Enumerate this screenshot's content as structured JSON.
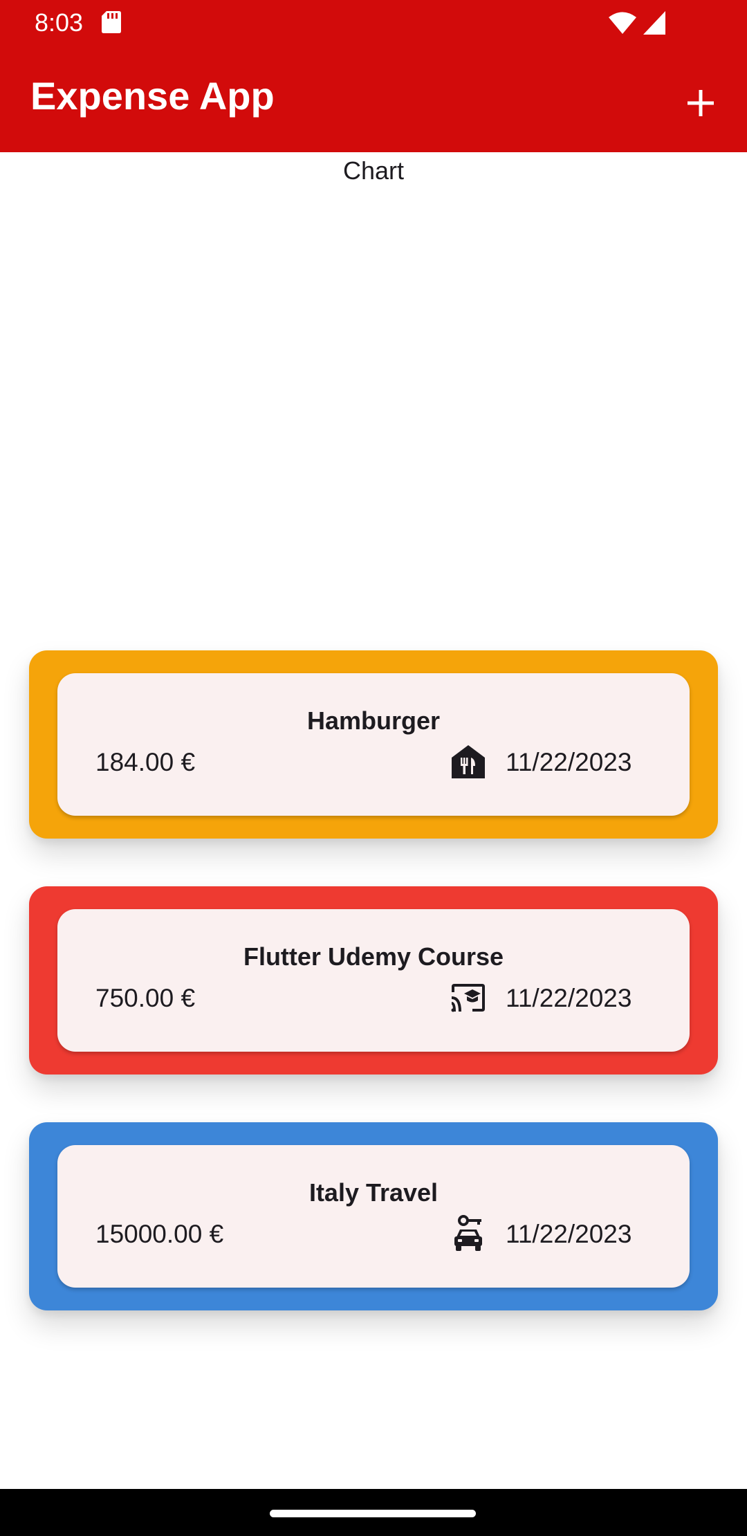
{
  "status_bar": {
    "time": "8:03",
    "icons": [
      "sd-card-icon",
      "wifi-icon",
      "cell-signal-icon"
    ]
  },
  "app_bar": {
    "title": "Expense App",
    "action_icon": "add-icon",
    "color": "#d20b0b"
  },
  "chart": {
    "label": "Chart"
  },
  "expenses": [
    {
      "title": "Hamburger",
      "amount": "184.00 €",
      "date": "11/22/2023",
      "icon": "restaurant-icon",
      "color": "#f5a40a"
    },
    {
      "title": "Flutter Udemy Course",
      "amount": "750.00 €",
      "date": "11/22/2023",
      "icon": "cast-for-education-icon",
      "color": "#ee3a31"
    },
    {
      "title": "Italy Travel",
      "amount": "15000.00 €",
      "date": "11/22/2023",
      "icon": "car-rental-icon",
      "color": "#3d86d8"
    }
  ]
}
